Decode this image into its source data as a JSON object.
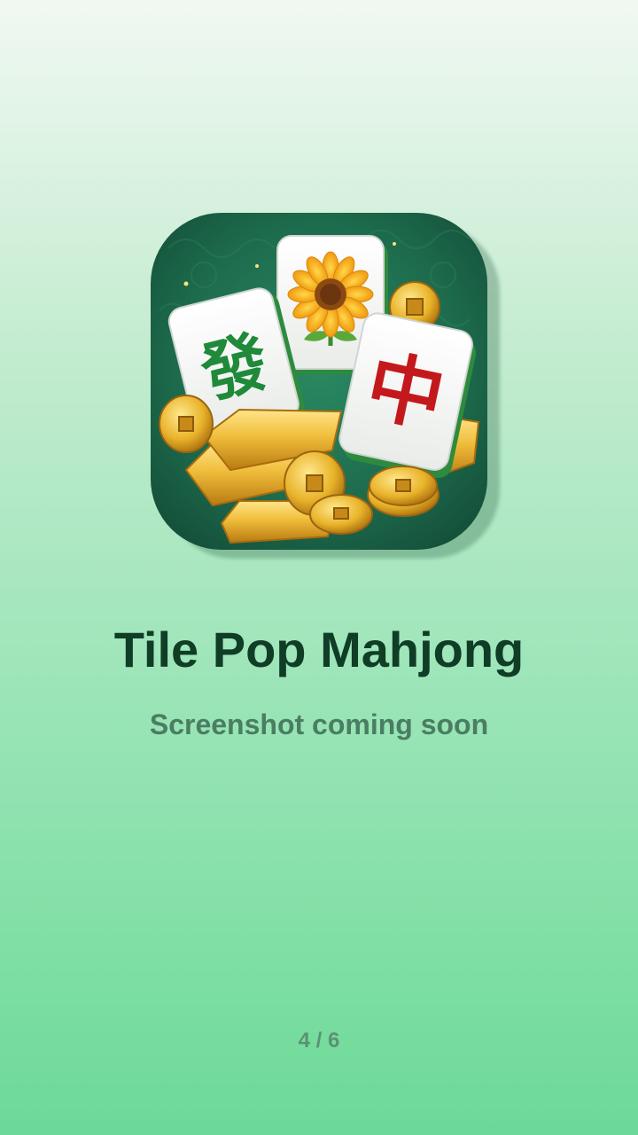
{
  "app": {
    "title": "Tile Pop Mahjong",
    "subtitle": "Screenshot coming soon",
    "icon": {
      "name": "tile-pop-mahjong-app-icon",
      "tiles": [
        {
          "glyph": "發",
          "color": "#1f8a3a"
        },
        {
          "glyph": "sunflower",
          "color": "#f2b81c"
        },
        {
          "glyph": "中",
          "color": "#c4191c"
        }
      ],
      "background_color": "#1d6b4d",
      "gold_color": "#e8b52c"
    }
  },
  "pager": {
    "indicator": "4 / 6",
    "current": 4,
    "total": 6
  },
  "colors": {
    "title": "#0f3d26",
    "subtitle": "#4a7d62",
    "pager": "#5a9272",
    "gradient_top": "#f1f8f2",
    "gradient_bottom": "#6cd998"
  }
}
